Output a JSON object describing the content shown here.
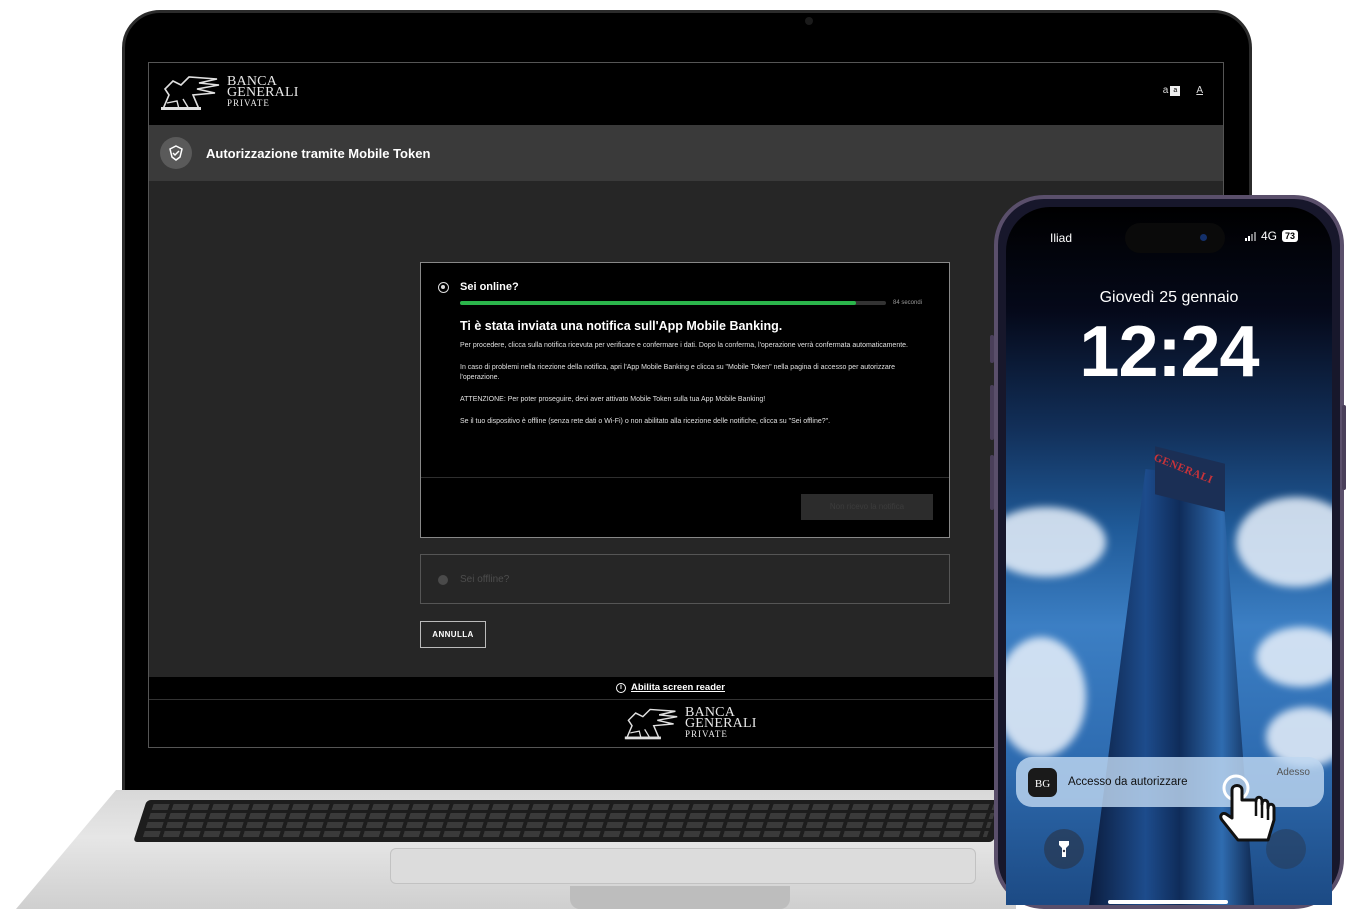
{
  "brand": {
    "line1": "BANCA",
    "line2": "GENERALI",
    "line3": "PRIVATE"
  },
  "header": {
    "contrast_label": "a",
    "contrast_box": "a",
    "font_label": "A"
  },
  "titlebar": {
    "title": "Autorizzazione tramite Mobile Token"
  },
  "online_panel": {
    "label": "Sei online?",
    "progress_fraction": 0.93,
    "progress_label": "84 secondi",
    "heading": "Ti è stata inviata una notifica sull'App Mobile Banking.",
    "paragraphs": [
      "Per procedere, clicca sulla notifica ricevuta per verificare e confermare i dati. Dopo la conferma, l'operazione verrà confermata automaticamente.",
      "In caso di problemi nella ricezione della notifica, apri l'App Mobile Banking e clicca su \"Mobile Token\" nella pagina di accesso per autorizzare l'operazione.",
      "ATTENZIONE: Per poter proseguire, devi aver attivato Mobile Token sulla tua App Mobile Banking!",
      "Se il tuo dispositivo è offline (senza rete dati o Wi-Fi) o non abilitato alla ricezione delle notifiche, clicca su \"Sei offline?\"."
    ],
    "disabled_button": "Non ricevo la notifica"
  },
  "offline_panel": {
    "label": "Sei offline?"
  },
  "cancel_button": "ANNULLA",
  "footer": {
    "screen_reader_link": "Abilita screen reader",
    "info_icon": "i"
  },
  "phone": {
    "carrier": "Iliad",
    "network": "4G",
    "battery": "73",
    "date": "Giovedì 25 gennaio",
    "time": "12:24",
    "tower_sign": "GENERALI",
    "notification": {
      "app_icon_text": "BG",
      "text": "Accesso da autorizzare",
      "time": "Adesso"
    }
  },
  "colors": {
    "progress": "#2bb54b",
    "screen_bg": "#262626",
    "titlebar_bg": "#3a3a3a"
  },
  "icons": [
    "shield-check-icon",
    "info-icon",
    "flashlight-icon",
    "pointing-hand-icon",
    "lion-logo-icon"
  ]
}
